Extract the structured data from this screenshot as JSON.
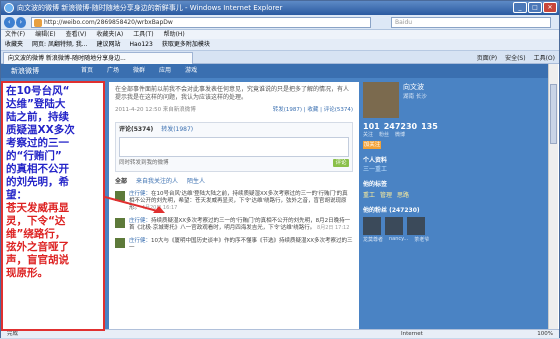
{
  "window": {
    "title": "向文波的微博 新浪微博-随时随地分享身边的新鲜事儿 - Windows Internet Explorer"
  },
  "address": {
    "url": "http://weibo.com/2869858420/wrbxBapDw",
    "search_placeholder": "Baidu"
  },
  "menu": [
    "文件(F)",
    "编辑(E)",
    "查看(V)",
    "收藏夹(A)",
    "工具(T)",
    "帮助(H)"
  ],
  "favorites": [
    "收藏夹",
    "网页: 凤翻特频, 我...",
    "建议网站",
    "Hao123",
    "获取更多附加模块"
  ],
  "tab": {
    "label": "向文波的微博 新浪微博-随时随地分享身边..."
  },
  "toolbar": [
    "页面(P)",
    "安全(S)",
    "工具(O)"
  ],
  "site": {
    "logo": "新浪微博",
    "nav": [
      "首页",
      "广场",
      "微群",
      "应用",
      "游戏"
    ]
  },
  "post": {
    "text": "在全部事件面前以前我不会对此事发表任何意见，究竟谁说的只是把多了解的情况，有人提示我是在这样的问题，我认为应该这样的处理。",
    "time": "2011-4-20 12:50 来自新浪微博",
    "actions": "转发(1987) | 收藏 | 评论(5374)"
  },
  "comments": {
    "tabs": [
      "评论(5374)",
      "转发(1987)"
    ],
    "also_forward": "同时转发到我的微博",
    "submit": "评论"
  },
  "filters": [
    "全部",
    "来自我关注的人",
    "陌生人"
  ],
  "feed": [
    {
      "user": "庄行健：",
      "text": "在10号台风'达维'登陆大陆之前，持续质疑湿XX多次考察过的三一的'行贿门'的真相不公开的刘先明，希望：苍天发威再显灵，下令'达维'绕路行，弦外之音，盲官胡说现原形。",
      "time": "4月20日 16:17"
    },
    {
      "user": "庄行健：",
      "text": "持续质疑湿XX多次考察过的三一的'行贿门'的真相不公开的刘先明，8月2日晚持一首《北极·京城寄托》八一官政观看时，明月四海发吉光，下令'达维'绕路行。",
      "time": "8月2日 17:12"
    },
    {
      "user": "庄行健：",
      "text": "10大与《厦明中国历史谈丰》作的序不懂事《节选》持续质疑湿XX多次考察过的三一",
      "time": ""
    }
  ],
  "profile": {
    "name": "向文波",
    "location": "湖南 长沙",
    "stats": [
      {
        "value": "101",
        "label": "关注"
      },
      {
        "value": "247230",
        "label": "粉丝"
      },
      {
        "value": "135",
        "label": "微博"
      }
    ],
    "follow": "加关注",
    "info_title": "个人资料",
    "company": "三一重工",
    "tags_title": "他的标签",
    "tags": [
      "重工",
      "管理",
      "思路"
    ],
    "fans_title": "他的粉丝 (247230)",
    "fan_names": [
      "龙莫尊者",
      "nancy...",
      "茶老爷"
    ]
  },
  "annotation": {
    "lines": [
      "在10号台风“",
      "达维”登陆大",
      "陆之前，持续",
      "质疑温XX多次",
      "考察过的三一",
      "的“行贿门”",
      "的真相不公开",
      "的刘先明，希",
      "望："
    ],
    "highlight": [
      "苍天发威再显",
      "灵，下令“达",
      "维”绕路行，",
      "弦外之音哑了",
      "声，盲官胡说",
      "现原形。"
    ]
  },
  "status": {
    "text": "完成",
    "zone": "Internet",
    "zoom": "100%"
  }
}
